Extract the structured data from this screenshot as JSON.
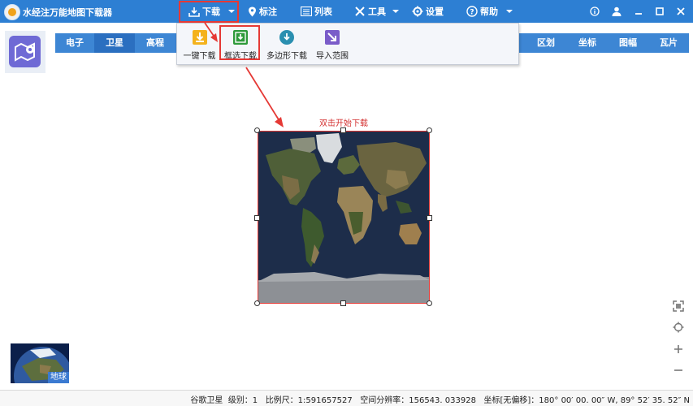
{
  "app": {
    "title": "水经注万能地图下载器"
  },
  "menu": {
    "download": "下载",
    "mark": "标注",
    "list": "列表",
    "tools": "工具",
    "settings": "设置",
    "help": "帮助"
  },
  "tabs_left": [
    {
      "label": "电子"
    },
    {
      "label": "卫星"
    },
    {
      "label": "高程"
    }
  ],
  "tabs_right": [
    {
      "label": "区划"
    },
    {
      "label": "坐标"
    },
    {
      "label": "图幅"
    },
    {
      "label": "瓦片"
    }
  ],
  "active_tab": "卫星",
  "dropdown": {
    "items": [
      {
        "label": "一键下载",
        "icon": "download-yellow-icon",
        "color": "#f4b21c"
      },
      {
        "label": "框选下载",
        "icon": "download-green-icon",
        "color": "#2e9a3a"
      },
      {
        "label": "多边形下载",
        "icon": "download-teal-icon",
        "color": "#2a8fb0"
      },
      {
        "label": "导入范围",
        "icon": "import-arrow-icon",
        "color": "#7a5cc9"
      }
    ]
  },
  "map": {
    "selection_hint": "双击开始下载"
  },
  "globe": {
    "label": "地球"
  },
  "status": {
    "source": "谷歌卫星",
    "level": "级别：1",
    "scale": "比例尺：1:591657527",
    "resolution": "空间分辨率：156543. 033928",
    "coords": "坐标[无偏移]：180° 00′ 00. 00″ W, 89° 52′ 35. 52″ N"
  },
  "colors": {
    "titlebar": "#2d7fd3",
    "toolbar": "#3d86d4",
    "highlight": "#e53935",
    "selection": "#d32f2f"
  }
}
